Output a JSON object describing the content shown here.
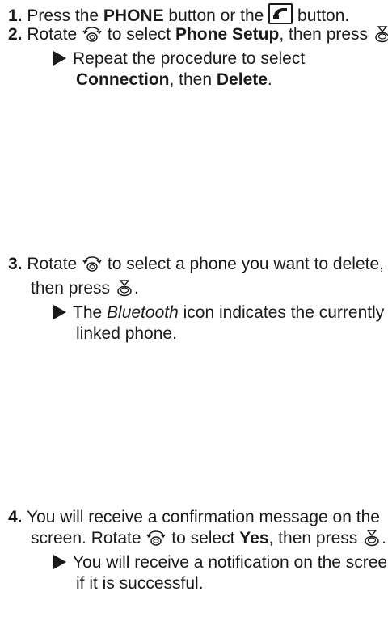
{
  "steps": [
    {
      "number": "1.",
      "t1": "Press the ",
      "b1": "PHONE",
      "t2": " button or the ",
      "t3": " button."
    },
    {
      "number": "2.",
      "t1": "Rotate ",
      "t2": " to select ",
      "b1": "Phone Setup",
      "t3": ", then press ",
      "t4": ".",
      "note": {
        "t1": "Repeat the procedure to select ",
        "b1": "Connection",
        "t2": ", then ",
        "b2": "Delete",
        "t3": "."
      }
    },
    {
      "number": "3.",
      "t1": "Rotate ",
      "t2": " to select a phone you want to delete, then press ",
      "t3": ".",
      "note": {
        "t1": "The ",
        "i1": "Bluetooth",
        "t2": " icon indicates the currently linked phone."
      }
    },
    {
      "number": "4.",
      "t1": "You will receive a confirmation message on the screen. Rotate ",
      "t2": " to select ",
      "b1": "Yes",
      "t3": ", then press ",
      "t4": ".",
      "note": {
        "t1": "You will receive a notification on the screen if it is successful."
      }
    }
  ],
  "icons": {
    "rotate": "rotate-knob-icon",
    "press": "press-knob-icon",
    "phone": "phone-handset-icon",
    "note_marker": "triangle-marker-icon"
  }
}
